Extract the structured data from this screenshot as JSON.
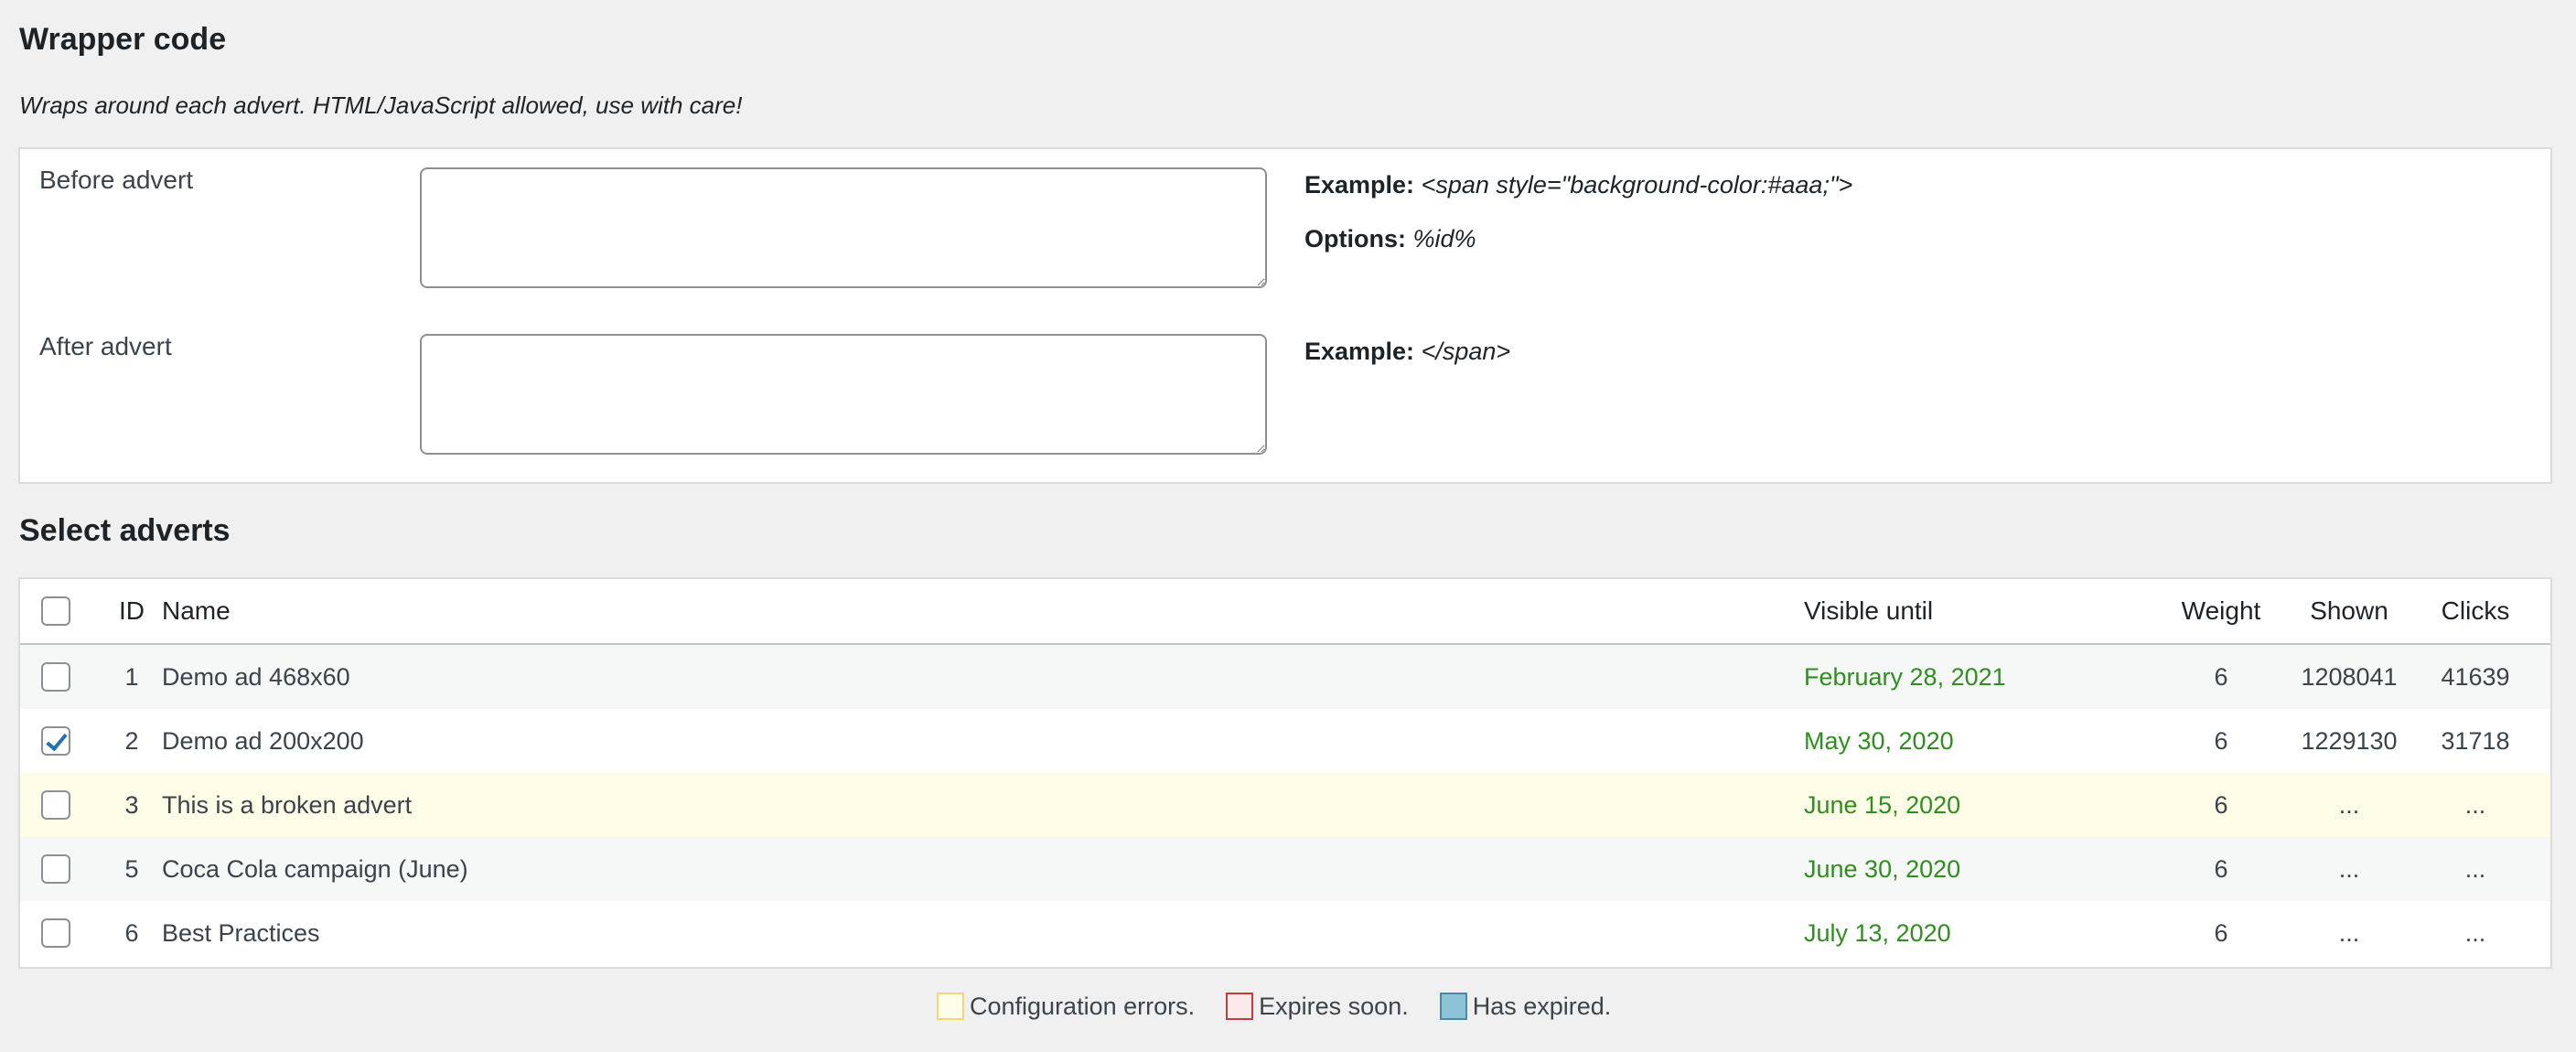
{
  "wrapper": {
    "heading": "Wrapper code",
    "description": "Wraps around each advert. HTML/JavaScript allowed, use with care!",
    "before": {
      "label": "Before advert",
      "value": "",
      "example_label": "Example:",
      "example_value": "<span style=\"background-color:#aaa;\">",
      "options_label": "Options:",
      "options_value": "%id%"
    },
    "after": {
      "label": "After advert",
      "value": "",
      "example_label": "Example:",
      "example_value": "</span>"
    }
  },
  "adverts": {
    "heading": "Select adverts",
    "columns": {
      "id": "ID",
      "name": "Name",
      "visible_until": "Visible until",
      "weight": "Weight",
      "shown": "Shown",
      "clicks": "Clicks"
    },
    "rows": [
      {
        "id": "1",
        "name": "Demo ad 468x60",
        "visible_until": "February 28, 2021",
        "weight": "6",
        "shown": "1208041",
        "clicks": "41639",
        "checked": false,
        "status": "normal"
      },
      {
        "id": "2",
        "name": "Demo ad 200x200",
        "visible_until": "May 30, 2020",
        "weight": "6",
        "shown": "1229130",
        "clicks": "31718",
        "checked": true,
        "status": "normal"
      },
      {
        "id": "3",
        "name": "This is a broken advert",
        "visible_until": "June 15, 2020",
        "weight": "6",
        "shown": "...",
        "clicks": "...",
        "checked": false,
        "status": "error"
      },
      {
        "id": "5",
        "name": "Coca Cola campaign (June)",
        "visible_until": "June 30, 2020",
        "weight": "6",
        "shown": "...",
        "clicks": "...",
        "checked": false,
        "status": "normal"
      },
      {
        "id": "6",
        "name": "Best Practices",
        "visible_until": "July 13, 2020",
        "weight": "6",
        "shown": "...",
        "clicks": "...",
        "checked": false,
        "status": "normal"
      }
    ]
  },
  "legend": {
    "config_errors": "Configuration errors.",
    "expires_soon": "Expires soon.",
    "has_expired": "Has expired."
  },
  "colors": {
    "date_text": "#2e8f1e",
    "error_row": "#fefde8",
    "config_swatch_bg": "#fefde8",
    "config_swatch_border": "#f0d77a",
    "expires_swatch_bg": "#fbeaea",
    "expires_swatch_border": "#c43d3d",
    "expired_swatch_bg": "#8dc3d6",
    "expired_swatch_border": "#4a8aa6"
  }
}
